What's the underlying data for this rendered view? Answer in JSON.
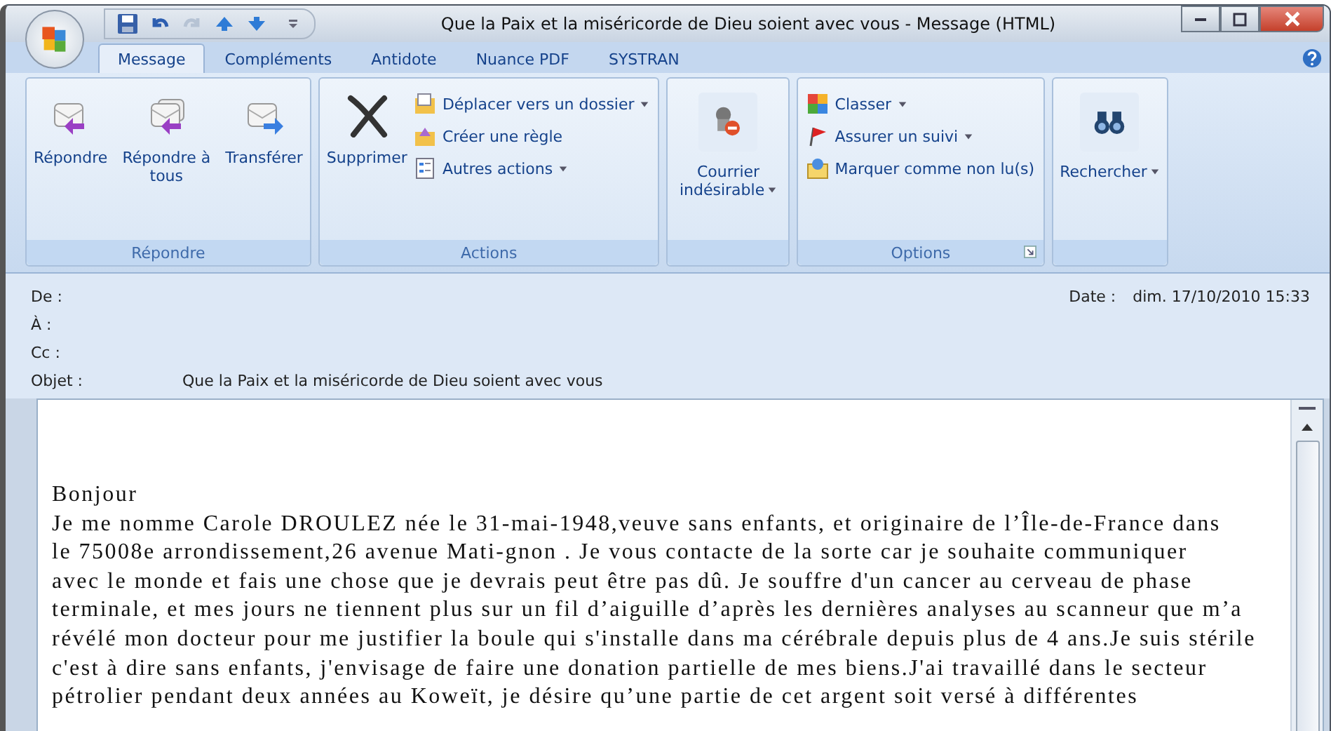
{
  "window": {
    "title": "Que la Paix et la miséricorde de Dieu soient avec vous - Message (HTML)"
  },
  "tabs": [
    {
      "label": "Message",
      "selected": true
    },
    {
      "label": "Compléments",
      "selected": false
    },
    {
      "label": "Antidote",
      "selected": false
    },
    {
      "label": "Nuance PDF",
      "selected": false
    },
    {
      "label": "SYSTRAN",
      "selected": false
    }
  ],
  "ribbon_groups": [
    {
      "label": "Répondre",
      "large": [
        {
          "label": "Répondre",
          "dropdown": false
        },
        {
          "label": "Répondre à tous",
          "dropdown": false
        },
        {
          "label": "Transférer",
          "dropdown": false
        }
      ],
      "launcher": false
    },
    {
      "label": "Actions",
      "large": [
        {
          "label": "Supprimer",
          "dropdown": false
        }
      ],
      "small": [
        {
          "label": "Déplacer vers un dossier",
          "dropdown": true
        },
        {
          "label": "Créer une règle",
          "dropdown": false
        },
        {
          "label": "Autres actions",
          "dropdown": true
        }
      ],
      "launcher": false
    },
    {
      "large": [
        {
          "label": "Courrier indésirable",
          "dropdown": true
        }
      ],
      "launcher": false
    },
    {
      "label": "Options",
      "small": [
        {
          "label": "Classer",
          "dropdown": true
        },
        {
          "label": "Assurer un suivi",
          "dropdown": true
        },
        {
          "label": "Marquer comme non lu(s)",
          "dropdown": false
        }
      ],
      "launcher": true
    },
    {
      "large": [
        {
          "label": "Rechercher",
          "dropdown": true
        }
      ],
      "launcher": false
    }
  ],
  "header": {
    "fields": [
      {
        "label": "De :"
      },
      {
        "label": "À :"
      },
      {
        "label": "Cc :"
      },
      {
        "label": "Objet :",
        "value": "Que la Paix et la miséricorde de Dieu soient avec vous"
      }
    ],
    "date": {
      "label": "Date :",
      "value": "dim. 17/10/2010 15:33"
    }
  },
  "body": {
    "greeting": "Bonjour",
    "lines": [
      "Je me nomme Carole DROULEZ née le 31-mai-1948,veuve sans enfants, et originaire de l’Île-de-France dans",
      "le 75008e arrondissement,26 avenue Mati-gnon . Je vous contacte de la sorte car je souhaite communiquer",
      "avec le monde et fais une chose que je devrais peut être pas dû. Je souffre d'un cancer au cerveau de phase",
      "terminale, et mes jours ne tiennent plus sur un fil d’aiguille d’après les dernières analyses au scanneur que m’a",
      "révélé mon docteur pour me justifier la boule qui s'installe dans ma cérébrale depuis plus de 4 ans.Je suis stérile",
      "c'est à dire sans enfants, j'envisage de faire une donation partielle de mes biens.J'ai travaillé dans le secteur",
      "pétrolier pendant deux années au Koweït, je désire qu’une partie de cet argent soit versé à différentes"
    ]
  }
}
